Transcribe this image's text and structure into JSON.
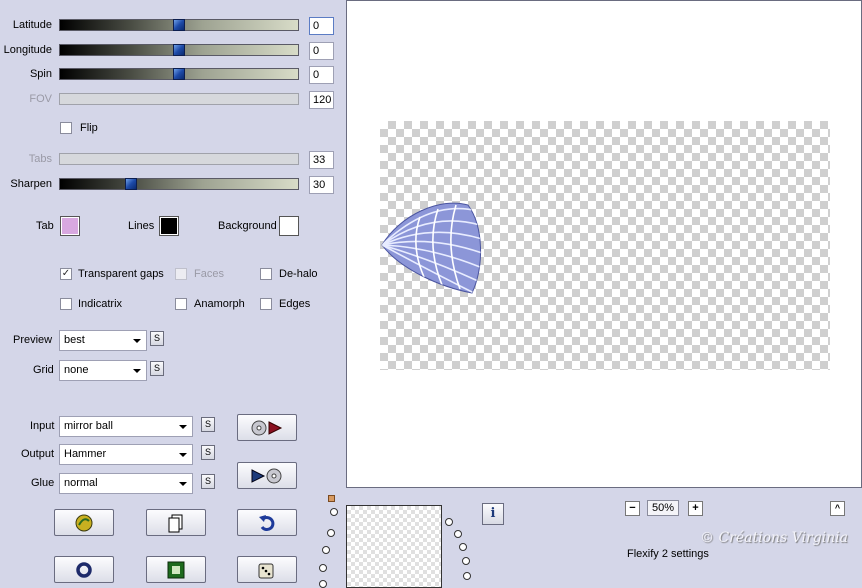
{
  "sliders": {
    "latitude": {
      "label": "Latitude",
      "value": "0",
      "level": 0.5
    },
    "longitude": {
      "label": "Longitude",
      "value": "0",
      "level": 0.5
    },
    "spin": {
      "label": "Spin",
      "value": "0",
      "level": 0.5
    },
    "fov": {
      "label": "FOV",
      "value": "120"
    },
    "tabs": {
      "label": "Tabs",
      "value": "33"
    },
    "sharpen": {
      "label": "Sharpen",
      "value": "30",
      "level": 0.3
    }
  },
  "flip": {
    "label": "Flip",
    "checked": false
  },
  "colors": {
    "tab_label": "Tab",
    "tab_color": "#d8a8e0",
    "lines_label": "Lines",
    "lines_color": "#000000",
    "background_label": "Background",
    "background_color": "#ffffff"
  },
  "options": {
    "transparent_gaps": {
      "label": "Transparent gaps",
      "checked": true
    },
    "faces": {
      "label": "Faces",
      "checked": false
    },
    "de_halo": {
      "label": "De-halo",
      "checked": false
    },
    "indicatrix": {
      "label": "Indicatrix",
      "checked": false
    },
    "anamorph": {
      "label": "Anamorph",
      "checked": false
    },
    "edges": {
      "label": "Edges",
      "checked": false
    }
  },
  "preview": {
    "label": "Preview",
    "value": "best"
  },
  "grid": {
    "label": "Grid",
    "value": "none"
  },
  "input": {
    "label": "Input",
    "value": "mirror ball"
  },
  "output": {
    "label": "Output",
    "value": "Hammer"
  },
  "glue": {
    "label": "Glue",
    "value": "normal"
  },
  "s_button_label": "S",
  "zoom": {
    "minus": "−",
    "value": "50%",
    "plus": "+"
  },
  "collapse_label": "^",
  "info_label": "i",
  "settings_label": "Flexify 2 settings",
  "watermark": "© Créations Virginia",
  "icons": {
    "rotate_left": "disc-play-icon",
    "rotate_right": "play-disc-icon",
    "logo": "flexify-logo-icon",
    "copy": "copy-page-icon",
    "undo": "undo-arrow-icon",
    "ring": "ring-icon",
    "frame": "green-frame-icon",
    "dice": "dice-icon"
  }
}
